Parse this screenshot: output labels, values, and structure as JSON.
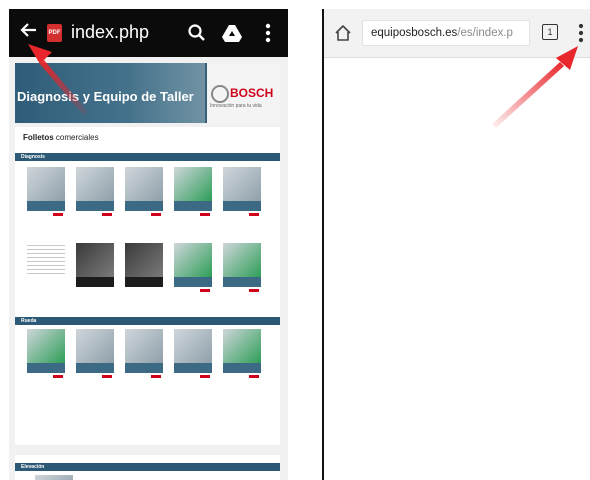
{
  "left_screen": {
    "toolbar": {
      "title": "index.php",
      "pdf_badge": "PDF",
      "icons": [
        "arrow-left-icon",
        "pdf-file-icon",
        "search-icon",
        "drive-icon",
        "more-vert-icon"
      ]
    },
    "document": {
      "banner_title": "Diagnosis y Equipo de Taller",
      "brand": "BOSCH",
      "brand_tagline": "Innovación para tu vida",
      "heading_bold": "Folletos",
      "heading_rest": " comerciales",
      "sections": [
        {
          "label": "Diagnosis"
        },
        {
          "label": "Rueda"
        },
        {
          "label": "Elevación"
        }
      ]
    }
  },
  "right_screen": {
    "url_host": "equiposbosch.es",
    "url_path": "/es/index.p",
    "tab_count": "1",
    "icons": [
      "home-icon",
      "tabs-icon",
      "more-vert-icon"
    ]
  },
  "annotation": {
    "arrow_color": "#e8262b",
    "count": 2
  }
}
